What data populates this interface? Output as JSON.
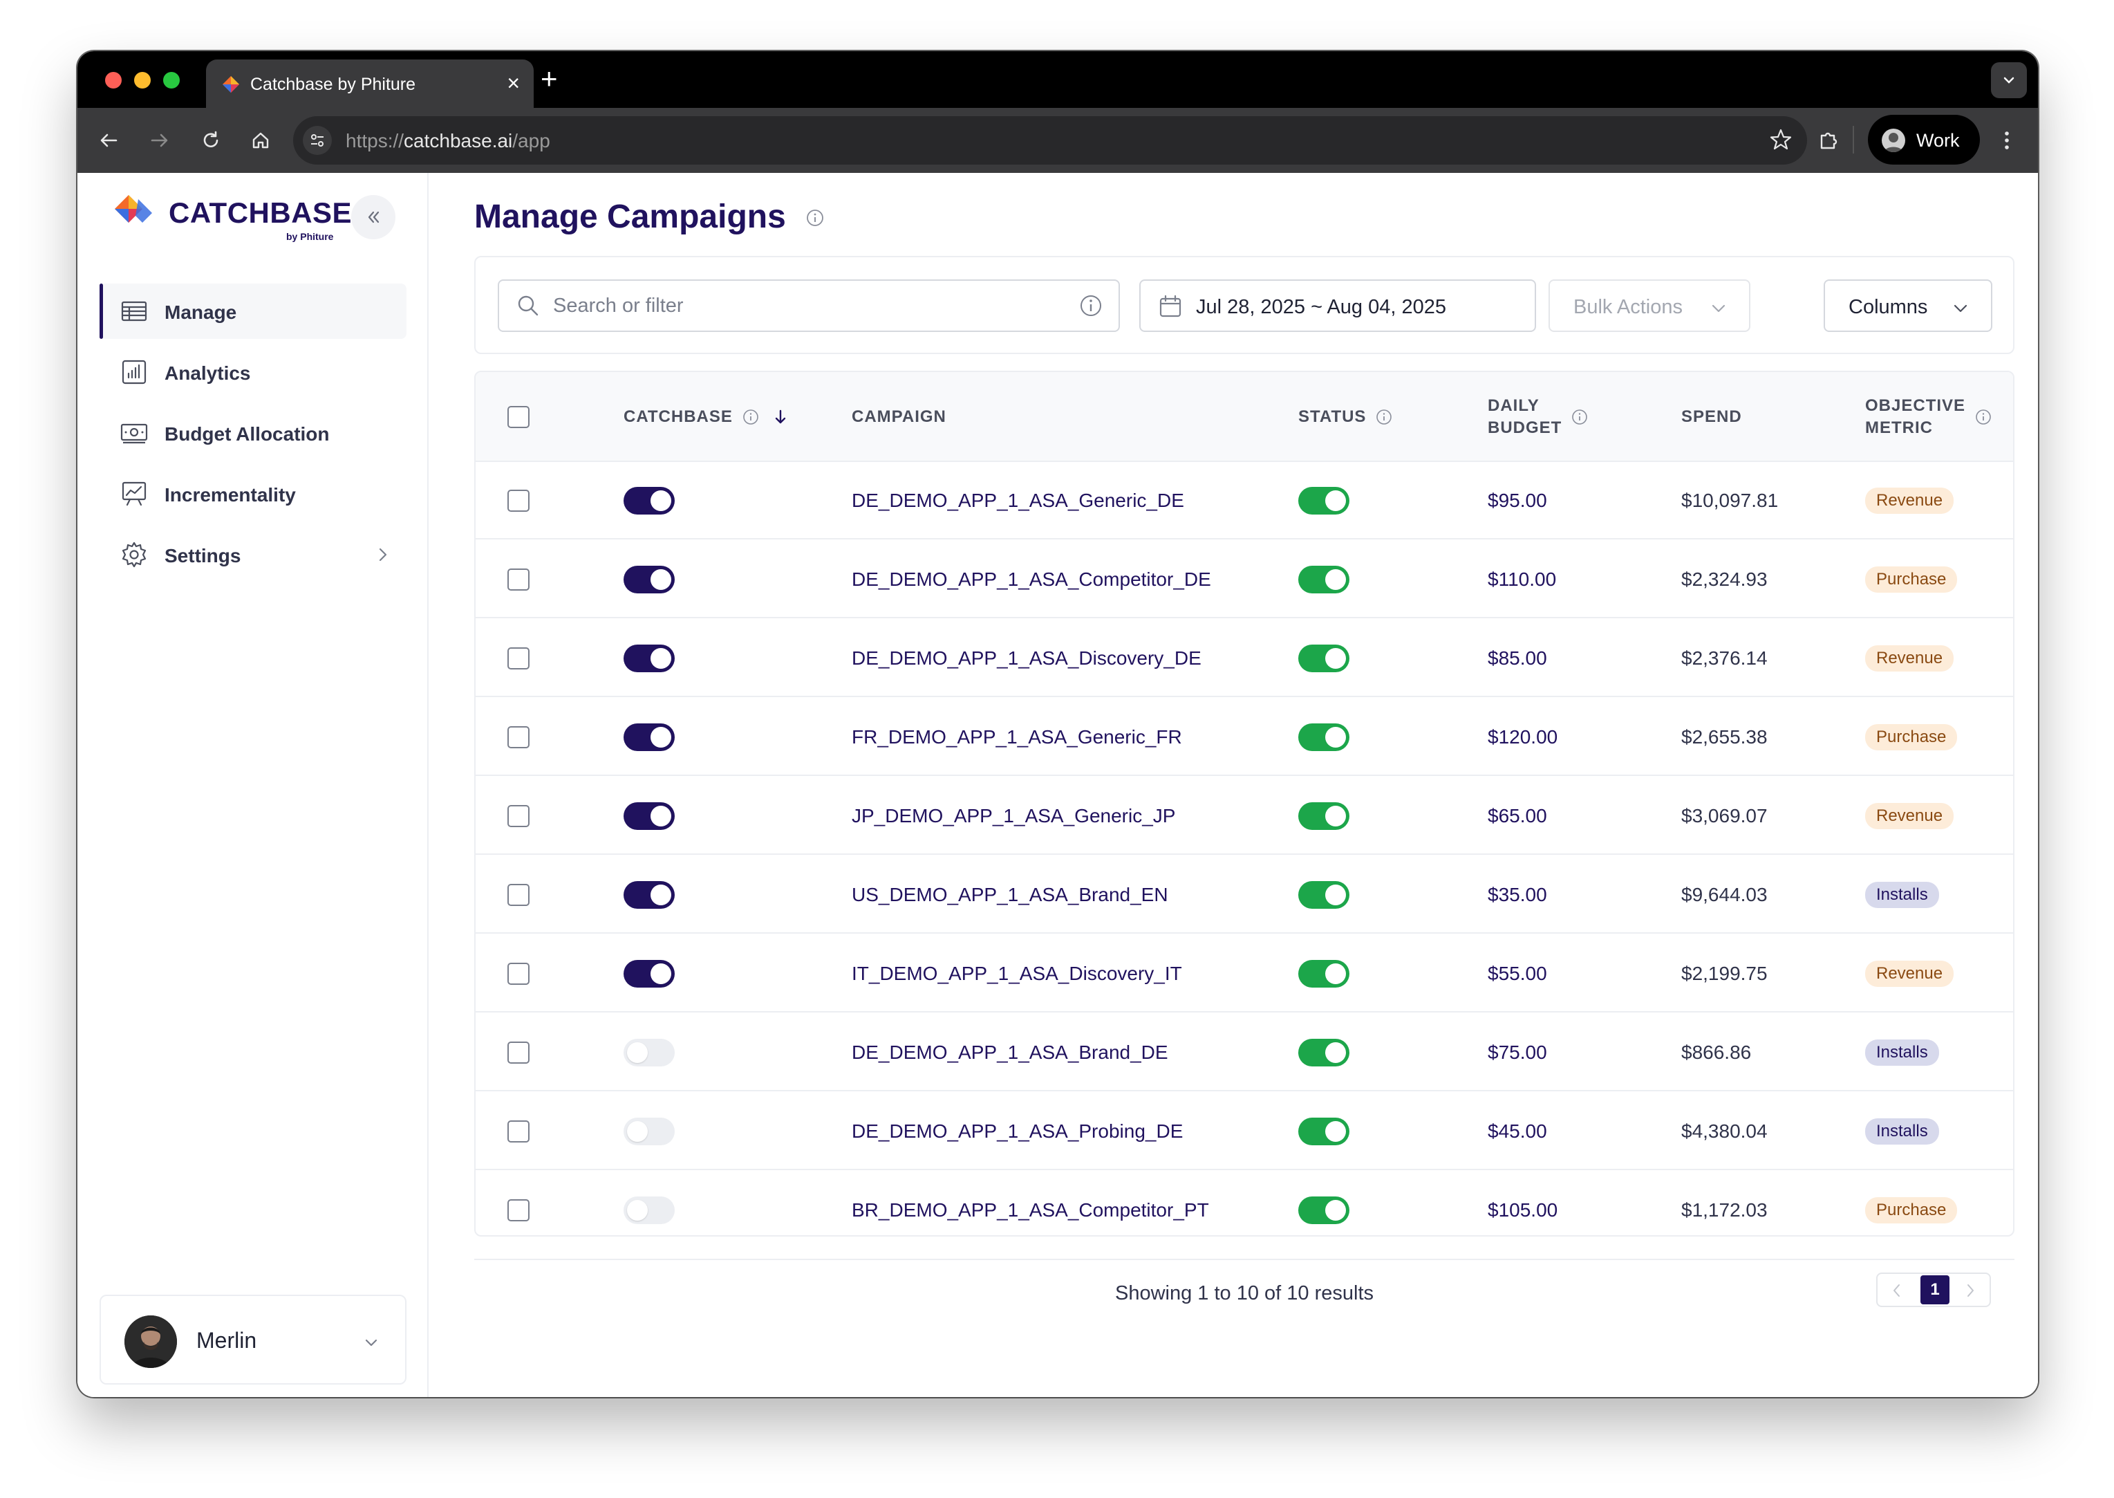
{
  "browser": {
    "tab_title": "Catchbase by Phiture",
    "tab_close": "×",
    "new_tab": "+",
    "url_scheme": "https://",
    "url_host": "catchbase.ai",
    "url_path": "/app",
    "profile_label": "Work"
  },
  "sidebar": {
    "logo_text": "CATCHBASE",
    "logo_sub": "by Phiture",
    "items": [
      {
        "label": "Manage",
        "icon": "table-icon",
        "active": true
      },
      {
        "label": "Analytics",
        "icon": "bar-chart-icon",
        "active": false
      },
      {
        "label": "Budget Allocation",
        "icon": "money-icon",
        "active": false
      },
      {
        "label": "Incrementality",
        "icon": "presentation-chart-icon",
        "active": false
      },
      {
        "label": "Settings",
        "icon": "gear-icon",
        "active": false,
        "has_submenu": true
      }
    ],
    "user": {
      "name": "Merlin"
    }
  },
  "main": {
    "title": "Manage Campaigns",
    "search": {
      "placeholder": "Search or filter",
      "value": ""
    },
    "date_range": "Jul 28, 2025 ~ Aug 04, 2025",
    "bulk_actions_label": "Bulk Actions",
    "columns_label": "Columns"
  },
  "table": {
    "headers": {
      "catchbase": "CATCHBASE",
      "campaign": "CAMPAIGN",
      "status": "STATUS",
      "daily_budget_1": "DAILY",
      "daily_budget_2": "BUDGET",
      "spend": "SPEND",
      "objective_1": "OBJECTIVE",
      "objective_2": "METRIC"
    },
    "rows": [
      {
        "catchbase_on": true,
        "campaign": "DE_DEMO_APP_1_ASA_Generic_DE",
        "status_on": true,
        "daily_budget": "$95.00",
        "spend": "$10,097.81",
        "objective": "Revenue"
      },
      {
        "catchbase_on": true,
        "campaign": "DE_DEMO_APP_1_ASA_Competitor_DE",
        "status_on": true,
        "daily_budget": "$110.00",
        "spend": "$2,324.93",
        "objective": "Purchase"
      },
      {
        "catchbase_on": true,
        "campaign": "DE_DEMO_APP_1_ASA_Discovery_DE",
        "status_on": true,
        "daily_budget": "$85.00",
        "spend": "$2,376.14",
        "objective": "Revenue"
      },
      {
        "catchbase_on": true,
        "campaign": "FR_DEMO_APP_1_ASA_Generic_FR",
        "status_on": true,
        "daily_budget": "$120.00",
        "spend": "$2,655.38",
        "objective": "Purchase"
      },
      {
        "catchbase_on": true,
        "campaign": "JP_DEMO_APP_1_ASA_Generic_JP",
        "status_on": true,
        "daily_budget": "$65.00",
        "spend": "$3,069.07",
        "objective": "Revenue"
      },
      {
        "catchbase_on": true,
        "campaign": "US_DEMO_APP_1_ASA_Brand_EN",
        "status_on": true,
        "daily_budget": "$35.00",
        "spend": "$9,644.03",
        "objective": "Installs"
      },
      {
        "catchbase_on": true,
        "campaign": "IT_DEMO_APP_1_ASA_Discovery_IT",
        "status_on": true,
        "daily_budget": "$55.00",
        "spend": "$2,199.75",
        "objective": "Revenue"
      },
      {
        "catchbase_on": false,
        "campaign": "DE_DEMO_APP_1_ASA_Brand_DE",
        "status_on": true,
        "daily_budget": "$75.00",
        "spend": "$866.86",
        "objective": "Installs"
      },
      {
        "catchbase_on": false,
        "campaign": "DE_DEMO_APP_1_ASA_Probing_DE",
        "status_on": true,
        "daily_budget": "$45.00",
        "spend": "$4,380.04",
        "objective": "Installs"
      },
      {
        "catchbase_on": false,
        "campaign": "BR_DEMO_APP_1_ASA_Competitor_PT",
        "status_on": true,
        "daily_budget": "$105.00",
        "spend": "$1,172.03",
        "objective": "Purchase"
      }
    ]
  },
  "pagination": {
    "summary": "Showing 1 to 10 of 10 results",
    "current_page": "1"
  },
  "colors": {
    "brand": "#20125e",
    "status_on": "#1ca64a",
    "badge_warm": "#fdecd9",
    "badge_installs": "#d7d9ec"
  }
}
